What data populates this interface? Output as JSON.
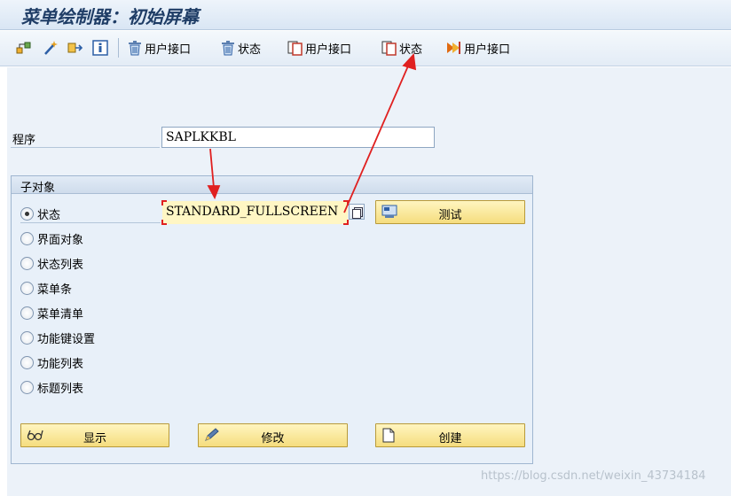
{
  "window": {
    "title": "菜单绘制器：初始屏幕"
  },
  "toolbar": {
    "items": [
      {
        "icon": "hierarchy-icon",
        "label": ""
      },
      {
        "icon": "magic-wand-icon",
        "label": ""
      },
      {
        "icon": "move-object-icon",
        "label": ""
      },
      {
        "icon": "info-icon",
        "label": ""
      },
      {
        "icon": "trash-icon",
        "label": "用户接口"
      },
      {
        "icon": "trash-icon",
        "label": "状态"
      },
      {
        "icon": "copy-icon",
        "label": "用户接口"
      },
      {
        "icon": "copy-icon",
        "label": "状态"
      },
      {
        "icon": "rename-icon",
        "label": "用户接口"
      }
    ]
  },
  "program": {
    "label": "程序",
    "value": "SAPLKKBL"
  },
  "subobjects": {
    "title": "子对象",
    "options": [
      {
        "label": "状态",
        "checked": true
      },
      {
        "label": "界面对象",
        "checked": false
      },
      {
        "label": "状态列表",
        "checked": false
      },
      {
        "label": "菜单条",
        "checked": false
      },
      {
        "label": "菜单清单",
        "checked": false
      },
      {
        "label": "功能键设置",
        "checked": false
      },
      {
        "label": "功能列表",
        "checked": false
      },
      {
        "label": "标题列表",
        "checked": false
      }
    ],
    "status_value": "STANDARD_FULLSCREEN",
    "test_button": "测试"
  },
  "actions": {
    "display": "显示",
    "change": "修改",
    "create": "创建"
  },
  "watermark": "https://blog.csdn.net/weixin_43734184",
  "colors": {
    "annotation_arrow": "#e02020",
    "button_yellow": "#f5dd7e",
    "title_blue": "#1f3d66"
  }
}
